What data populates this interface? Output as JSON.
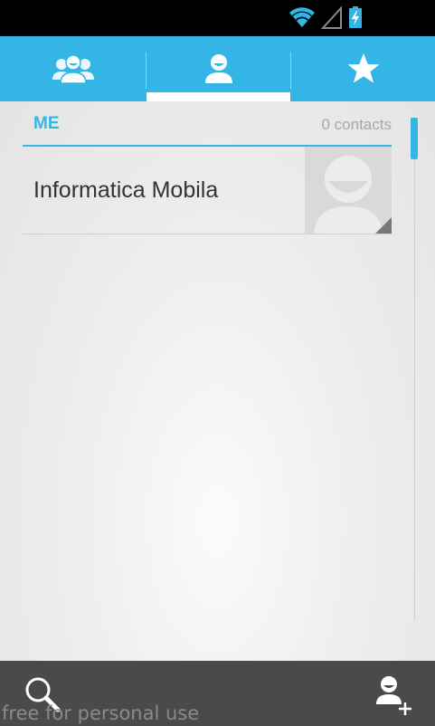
{
  "status_bar": {
    "icons": [
      "wifi-icon",
      "signal-icon",
      "battery-charging-icon"
    ]
  },
  "tabs": [
    {
      "name": "groups",
      "icon": "groups-icon",
      "selected": false
    },
    {
      "name": "me",
      "icon": "person-icon",
      "selected": true
    },
    {
      "name": "favorites",
      "icon": "star-icon",
      "selected": false
    }
  ],
  "section": {
    "title": "ME",
    "count": "0 contacts"
  },
  "contact": {
    "name": "Informatica Mobila",
    "avatar_icon": "default-avatar-icon"
  },
  "bottom_bar": {
    "search_icon": "search-icon",
    "add_icon": "add-contact-icon"
  },
  "watermark": "free for personal use",
  "colors": {
    "accent": "#33b5e5",
    "status_bar": "#000000",
    "bottom_bar": "#4a4a4a"
  }
}
